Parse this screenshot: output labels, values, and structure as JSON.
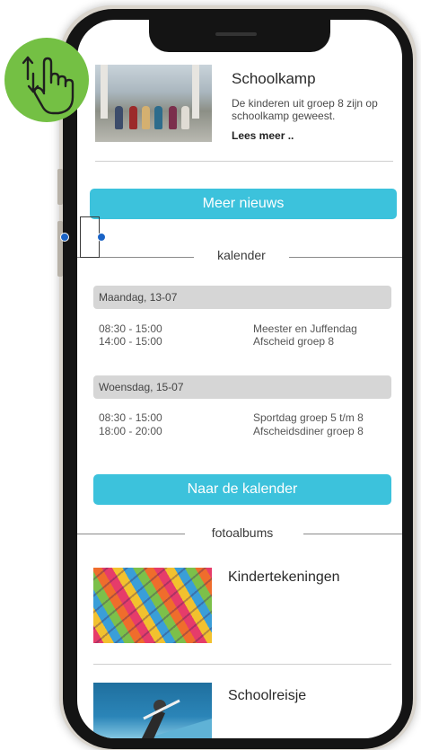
{
  "news": {
    "title": "Schoolkamp",
    "text": "De kinderen uit groep 8 zijn op schoolkamp geweest.",
    "more": "Lees meer .."
  },
  "buttons": {
    "more_news": "Meer nieuws",
    "to_calendar": "Naar de kalender"
  },
  "calendar": {
    "heading": "kalender",
    "days": [
      {
        "label": "Maandag, 13-07",
        "events": [
          {
            "time": "08:30 - 15:00",
            "name": "Meester en Juffendag"
          },
          {
            "time": "14:00 - 15:00",
            "name": "Afscheid groep 8"
          }
        ]
      },
      {
        "label": "Woensdag, 15-07",
        "events": [
          {
            "time": "08:30 - 15:00",
            "name": "Sportdag groep 5 t/m 8"
          },
          {
            "time": "18:00 - 20:00",
            "name": "Afscheidsdiner groep 8"
          }
        ]
      }
    ]
  },
  "albums": {
    "heading": "fotoalbums",
    "items": [
      {
        "title": "Kindertekeningen"
      },
      {
        "title": "Schoolreisje"
      }
    ]
  },
  "icons": {
    "gesture": "scroll-gesture-hand-icon"
  },
  "colors": {
    "accent": "#3cc2dc",
    "gesture_badge": "#74c044",
    "day_bar": "#d6d6d6",
    "selection_dot": "#1a63c6"
  }
}
